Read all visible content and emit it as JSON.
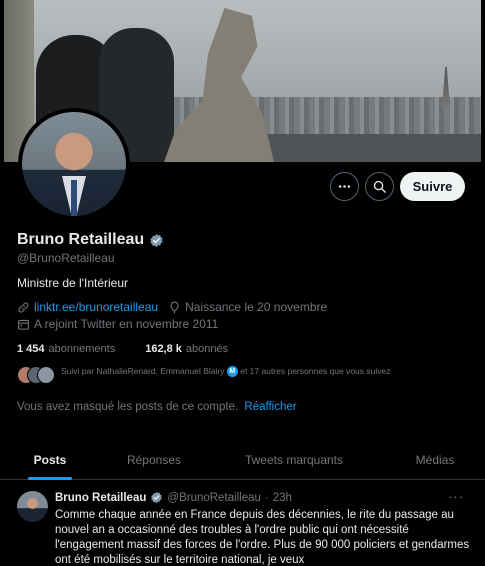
{
  "colors": {
    "accent": "#1d9bf0",
    "background": "#000000",
    "muted": "#71767b",
    "text": "#e7e9ea"
  },
  "header": {
    "more_icon": "more-horizontal-icon",
    "search_icon": "search-icon",
    "follow_label": "Suivre"
  },
  "profile": {
    "name": "Bruno Retailleau",
    "handle": "@BrunoRetailleau",
    "bio": "Ministre de l'Intérieur",
    "link": "linktr.ee/brunoretailleau",
    "birthday": "Naissance le 20 novembre",
    "joined": "A rejoint Twitter en novembre 2011",
    "following_count": "1 454",
    "following_label": "abonnements",
    "followers_count": "162,8 k",
    "followers_label": "abonnés",
    "followed_by_prefix": "Suivi par NathalieRenard, Emmanuel Blairy",
    "followed_by_suffix": "et 17 autres personnes que vous suivez",
    "badge_letter": "M",
    "masked_text": "Vous avez masqué les posts de ce compte.",
    "masked_action": "Réafficher"
  },
  "tabs": [
    {
      "label": "Posts",
      "active": true
    },
    {
      "label": "Réponses",
      "active": false
    },
    {
      "label": "Tweets marquants",
      "active": false
    },
    {
      "label": "Médias",
      "active": false
    }
  ],
  "tweet": {
    "name": "Bruno Retailleau",
    "handle": "@BrunoRetailleau",
    "separator": "·",
    "time": "23h",
    "more": "···",
    "text": "Comme chaque année en France depuis des décennies, le rite du passage au nouvel an a occasionné des troubles à l'ordre public qui ont nécessité l'engagement massif des forces de l'ordre. Plus de 90 000 policiers et gendarmes ont été mobilisés sur le territoire national, je veux"
  }
}
